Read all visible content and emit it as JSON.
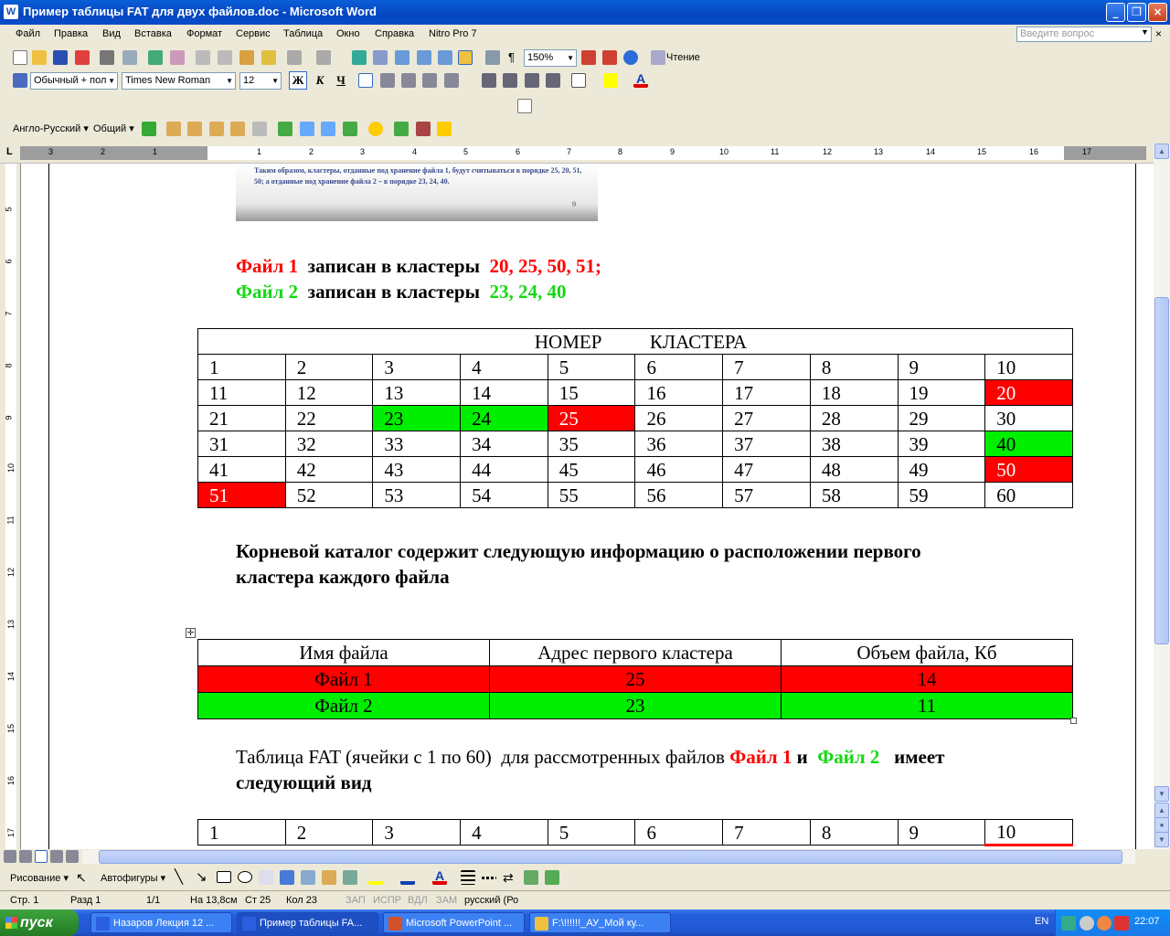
{
  "window": {
    "title": "Пример таблицы FAT для двух файлов.doc - Microsoft Word",
    "min": "_",
    "max": "❐",
    "close": "×"
  },
  "menu": {
    "items": [
      "Файл",
      "Правка",
      "Вид",
      "Вставка",
      "Формат",
      "Сервис",
      "Таблица",
      "Окно",
      "Справка",
      "Nitro Pro 7"
    ],
    "ask_placeholder": "Введите вопрос",
    "close": "×"
  },
  "toolbar": {
    "zoom": "150%",
    "reading_label": "Чтение",
    "style": "Обычный + пол",
    "font": "Times New Roman",
    "size": "12",
    "bold": "Ж",
    "italic": "К",
    "underline": "Ч",
    "translate_lang": "Англо-Русский",
    "translate_scope": "Общий",
    "pilcrow": "¶"
  },
  "ruler": {
    "h": [
      "3",
      "2",
      "1",
      "1",
      "2",
      "3",
      "4",
      "5",
      "6",
      "7",
      "8",
      "9",
      "10",
      "11",
      "12",
      "13",
      "14",
      "15",
      "16",
      "17"
    ],
    "v": [
      "5",
      "6",
      "7",
      "8",
      "9",
      "10",
      "11",
      "12",
      "13",
      "14",
      "15",
      "16",
      "17"
    ],
    "corner": "L"
  },
  "doc": {
    "image_caption": "Таким образом, кластеры, отданные под хранение файла 1, будут считываться в порядке 25, 20, 51, 50; а отданные под хранение файла 2 – в порядке 23, 24, 40.",
    "image_pagenum": "9",
    "file1": {
      "name": "Файл 1",
      "text": "записан в кластеры",
      "clusters": "20, 25, 50, 51;"
    },
    "file2": {
      "name": "Файл 2",
      "text": "записан в кластеры",
      "clusters": "23, 24, 40"
    },
    "cluster_header": "НОМЕР          КЛАСТЕРА",
    "cluster_rows": [
      [
        "1",
        "2",
        "3",
        "4",
        "5",
        "6",
        "7",
        "8",
        "9",
        "10"
      ],
      [
        "11",
        "12",
        "13",
        "14",
        "15",
        "16",
        "17",
        "18",
        "19",
        "20"
      ],
      [
        "21",
        "22",
        "23",
        "24",
        "25",
        "26",
        "27",
        "28",
        "29",
        "30"
      ],
      [
        "31",
        "32",
        "33",
        "34",
        "35",
        "36",
        "37",
        "38",
        "39",
        "40"
      ],
      [
        "41",
        "42",
        "43",
        "44",
        "45",
        "46",
        "47",
        "48",
        "49",
        "50"
      ],
      [
        "51",
        "52",
        "53",
        "54",
        "55",
        "56",
        "57",
        "58",
        "59",
        "60"
      ]
    ],
    "red_cells": [
      "20",
      "25",
      "50",
      "51"
    ],
    "green_cells": [
      "23",
      "24",
      "40"
    ],
    "root_para_line1": "Корневой каталог содержит следующую информацию о расположении первого",
    "root_para_line2": "кластера каждого файла",
    "file_table": {
      "headers": [
        "Имя файла",
        "Адрес первого кластера",
        "Объем файла, Кб"
      ],
      "rows": [
        [
          "Файл  1",
          "25",
          "14"
        ],
        [
          "Файл 2",
          "23",
          "11"
        ]
      ]
    },
    "fat_para": {
      "prefix": "Таблица FAT (ячейки с 1 по 60)  для рассмотренных файлов ",
      "f1": "Файл 1",
      "and": " и  ",
      "f2": "Файл 2",
      "suffix": "   имеет",
      "line2": "следующий вид"
    },
    "fat_row": [
      "1",
      "2",
      "3",
      "4",
      "5",
      "6",
      "7",
      "8",
      "9",
      "10"
    ]
  },
  "drawbar": {
    "draw": "Рисование",
    "autoshapes": "Автофигуры"
  },
  "status": {
    "page": "Стр. 1",
    "section": "Разд  1",
    "pages": "1/1",
    "at": "На  13,8см",
    "line": "Ст  25",
    "col": "Кол  23",
    "rec": "ЗАП",
    "trk": "ИСПР",
    "ext": "ВДЛ",
    "ovr": "ЗАМ",
    "lang": "русский (Ро"
  },
  "taskbar": {
    "start": "пуск",
    "tasks": [
      "Назаров Лекция 12 ...",
      "Пример таблицы FA...",
      "Microsoft PowerPoint ...",
      "F:\\!!!!!!_АУ_Мой ку..."
    ],
    "lang": "EN",
    "time": "22:07"
  }
}
